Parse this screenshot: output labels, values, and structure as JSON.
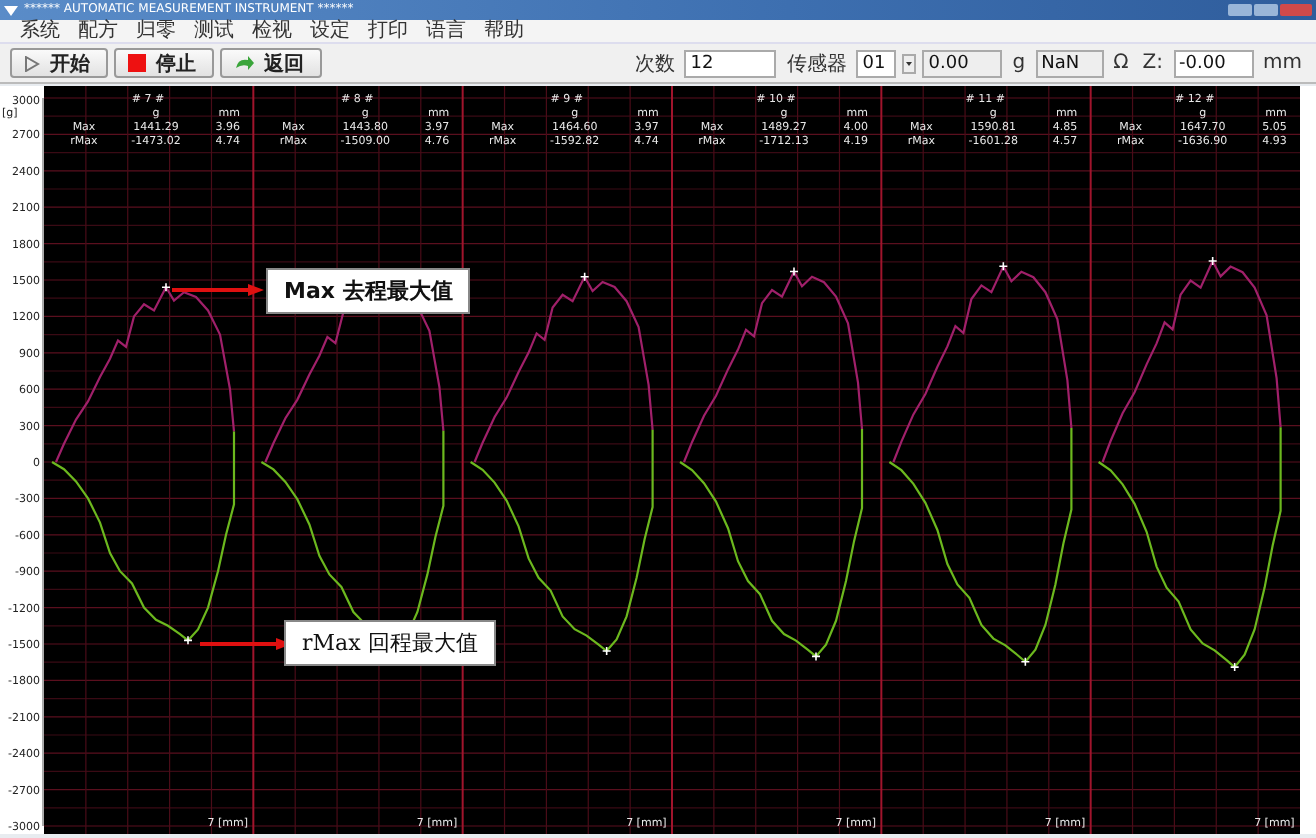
{
  "window": {
    "title": "****** AUTOMATIC MEASUREMENT INSTRUMENT ******"
  },
  "menu": [
    "系统",
    "配方",
    "归零",
    "测试",
    "检视",
    "设定",
    "打印",
    "语言",
    "帮助"
  ],
  "toolbar": {
    "buttons": [
      {
        "label": "开始",
        "kind": "start"
      },
      {
        "label": "停止",
        "kind": "stop"
      },
      {
        "label": "返回",
        "kind": "back"
      }
    ],
    "count": {
      "label": "次数",
      "value": "12"
    },
    "sensor": {
      "label": "传感器",
      "value": "01"
    },
    "force": {
      "value": "0.00",
      "unit": "g"
    },
    "resistance": {
      "value": "NaN",
      "unit": "Ω"
    },
    "z": {
      "label": "Z:",
      "value": "-0.00",
      "unit": "mm"
    }
  },
  "chart": {
    "y_unit": "[g]",
    "y_ticks": [
      "3000",
      "2700",
      "2400",
      "2100",
      "1800",
      "1500",
      "1200",
      "900",
      "600",
      "300",
      "0",
      "-300",
      "-600",
      "-900",
      "-1200",
      "-1500",
      "-1800",
      "-2100",
      "-2400",
      "-2700",
      "-3000"
    ],
    "panels": [
      {
        "title": "# 7 #",
        "units": [
          "g",
          "mm"
        ],
        "max": [
          "Max",
          "1441.29",
          "3.96"
        ],
        "rmax": [
          "rMax",
          "-1473.02",
          "4.74"
        ],
        "x_label": "7 [mm]"
      },
      {
        "title": "# 8 #",
        "units": [
          "g",
          "mm"
        ],
        "max": [
          "Max",
          "1443.80",
          "3.97"
        ],
        "rmax": [
          "rMax",
          "-1509.00",
          "4.76"
        ],
        "x_label": "7 [mm]"
      },
      {
        "title": "# 9 #",
        "units": [
          "g",
          "mm"
        ],
        "max": [
          "Max",
          "1464.60",
          "3.97"
        ],
        "rmax": [
          "rMax",
          "-1592.82",
          "4.74"
        ],
        "x_label": "7 [mm]"
      },
      {
        "title": "# 10 #",
        "units": [
          "g",
          "mm"
        ],
        "max": [
          "Max",
          "1489.27",
          "4.00"
        ],
        "rmax": [
          "rMax",
          "-1712.13",
          "4.19"
        ],
        "x_label": "7 [mm]"
      },
      {
        "title": "# 11 #",
        "units": [
          "g",
          "mm"
        ],
        "max": [
          "Max",
          "1590.81",
          "4.85"
        ],
        "rmax": [
          "rMax",
          "-1601.28",
          "4.57"
        ],
        "x_label": "7 [mm]"
      },
      {
        "title": "# 12 #",
        "units": [
          "g",
          "mm"
        ],
        "max": [
          "Max",
          "1647.70",
          "5.05"
        ],
        "rmax": [
          "rMax",
          "-1636.90",
          "4.93"
        ],
        "x_label": "7 [mm]"
      }
    ]
  },
  "callouts": [
    {
      "kind": "max",
      "text": "Max 去程最大值"
    },
    {
      "kind": "rmax",
      "text": "rMax 回程最大值"
    }
  ]
}
